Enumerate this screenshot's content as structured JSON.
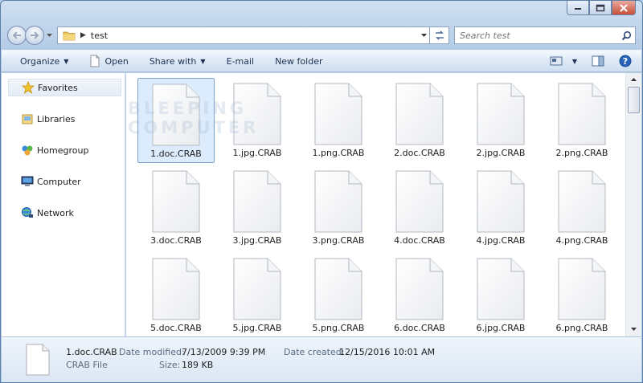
{
  "window": {
    "caption_buttons": [
      "minimize-icon",
      "maximize-icon",
      "close-icon"
    ]
  },
  "address": {
    "path": "test",
    "search_placeholder": "Search test"
  },
  "toolbar": {
    "organize": "Organize",
    "open": "Open",
    "share_with": "Share with",
    "email": "E-mail",
    "new_folder": "New folder"
  },
  "nav": {
    "favorites": "Favorites",
    "libraries": "Libraries",
    "homegroup": "Homegroup",
    "computer": "Computer",
    "network": "Network"
  },
  "watermark": [
    "BLEEPING",
    "COMPUTER"
  ],
  "files": [
    "1.doc.CRAB",
    "1.jpg.CRAB",
    "1.png.CRAB",
    "2.doc.CRAB",
    "2.jpg.CRAB",
    "2.png.CRAB",
    "3.doc.CRAB",
    "3.jpg.CRAB",
    "3.png.CRAB",
    "4.doc.CRAB",
    "4.jpg.CRAB",
    "4.png.CRAB",
    "5.doc.CRAB",
    "5.jpg.CRAB",
    "5.png.CRAB",
    "6.doc.CRAB",
    "6.jpg.CRAB",
    "6.png.CRAB"
  ],
  "selected_index": 0,
  "details": {
    "name": "1.doc.CRAB",
    "type": "CRAB File",
    "date_modified_label": "Date modified:",
    "date_modified": "7/13/2009 9:39 PM",
    "size_label": "Size:",
    "size": "189 KB",
    "date_created_label": "Date created:",
    "date_created": "12/15/2016 10:01 AM"
  }
}
